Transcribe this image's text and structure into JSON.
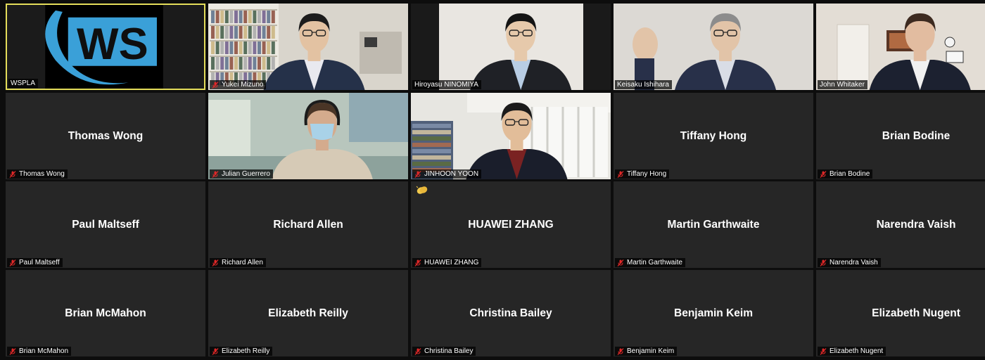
{
  "tiles": [
    {
      "name": "WSPLA",
      "type": "logo",
      "active": true,
      "muted": false,
      "logo_text": "WS"
    },
    {
      "name": "Yukei Mizuno",
      "type": "video",
      "muted": true
    },
    {
      "name": "Hiroyasu NINOMIYA",
      "type": "video",
      "muted": false
    },
    {
      "name": "Keisaku Ishihara",
      "type": "video",
      "muted": false
    },
    {
      "name": "John Whitaker",
      "type": "video",
      "muted": false
    },
    {
      "name": "Thomas Wong",
      "type": "name",
      "muted": true
    },
    {
      "name": "Julian Guerrero",
      "type": "video",
      "muted": true
    },
    {
      "name": "JINHOON YOON",
      "type": "video",
      "muted": true
    },
    {
      "name": "Tiffany Hong",
      "type": "name",
      "muted": true
    },
    {
      "name": "Brian Bodine",
      "type": "name",
      "muted": true
    },
    {
      "name": "Paul Maltseff",
      "type": "name",
      "muted": true
    },
    {
      "name": "Richard Allen",
      "type": "name",
      "muted": true
    },
    {
      "name": "HUAWEI ZHANG",
      "type": "name",
      "muted": true,
      "reaction": "clapping-hands-icon"
    },
    {
      "name": "Martin Garthwaite",
      "type": "name",
      "muted": true
    },
    {
      "name": "Narendra Vaish",
      "type": "name",
      "muted": true
    },
    {
      "name": "Brian McMahon",
      "type": "name",
      "muted": true
    },
    {
      "name": "Elizabeth Reilly",
      "type": "name",
      "muted": true
    },
    {
      "name": "Christina Bailey",
      "type": "name",
      "muted": true
    },
    {
      "name": "Benjamin Keim",
      "type": "name",
      "muted": true
    },
    {
      "name": "Elizabeth Nugent",
      "type": "name",
      "muted": true
    }
  ],
  "colors": {
    "background": "#0d0d0d",
    "tile": "#262626",
    "active_border": "#e4dd5a",
    "muted_mic": "#e02828",
    "logo_blue": "#3aa0d8"
  }
}
